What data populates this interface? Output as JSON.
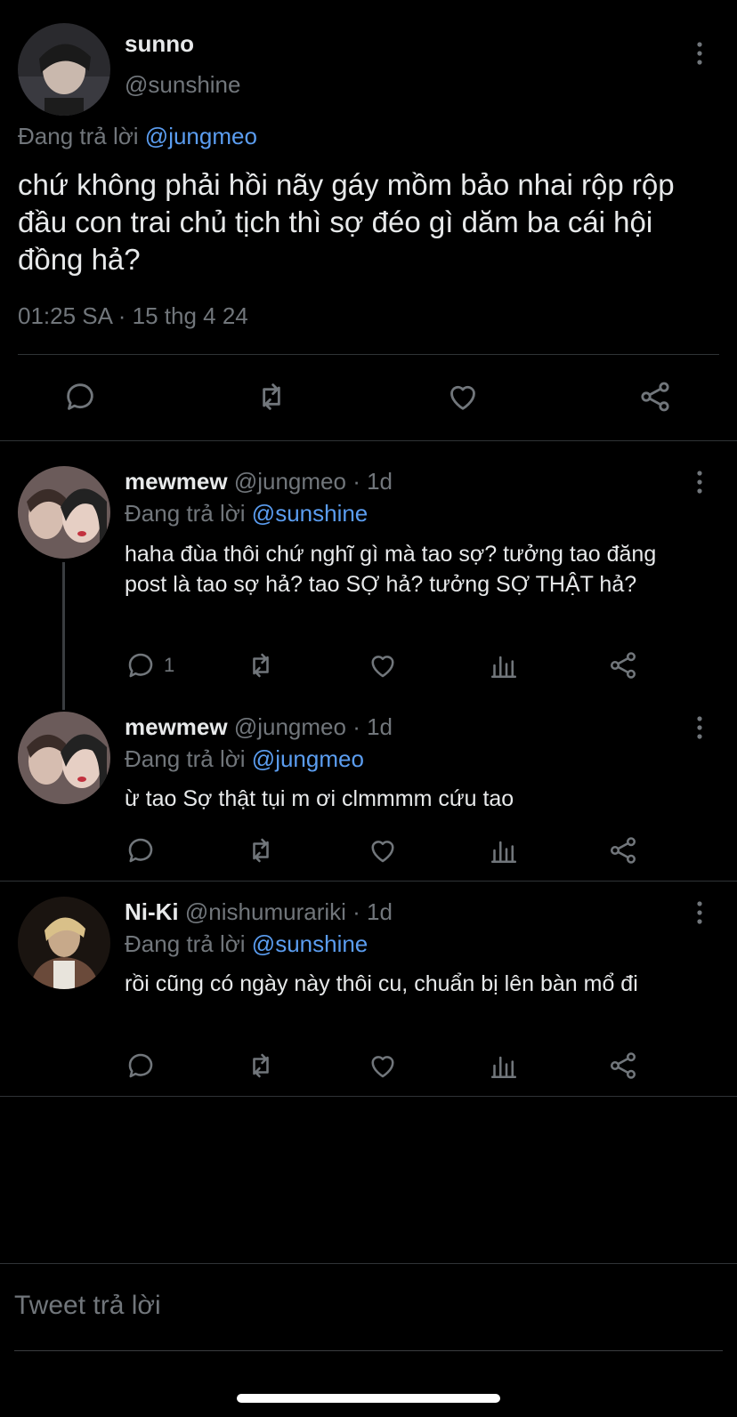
{
  "main_tweet": {
    "name": "sunno",
    "handle": "@sunshine",
    "replying_prefix": "Đang trả lời",
    "replying_to": "@jungmeo",
    "text": "chứ không phải hồi nãy gáy mồm bảo nhai rộp rộp đầu con trai chủ tịch thì sợ đéo gì dăm ba cái hội đồng hả?",
    "timestamp": "01:25 SA · 15 thg 4 24",
    "actions": [
      "reply-icon",
      "retweet-icon",
      "like-icon",
      "share-icon"
    ]
  },
  "replies": [
    {
      "name": "mewmew",
      "handle": "@jungmeo",
      "time": "· 1d",
      "replying_prefix": "Đang trả lời",
      "replying_to": "@sunshine",
      "text": "haha đùa thôi chứ nghĩ gì mà tao sợ? tưởng tao đăng post là tao sợ hả? tao SỢ hả? tưởng SỢ THẬT hả?",
      "reply_count": "1"
    },
    {
      "name": "mewmew",
      "handle": "@jungmeo",
      "time": "· 1d",
      "replying_prefix": "Đang trả lời",
      "replying_to": "@jungmeo",
      "text": "ừ tao Sợ thật tụi m ơi clmmmm cứu tao",
      "reply_count": ""
    },
    {
      "name": "Ni-Ki",
      "handle": "@nishumurariki",
      "time": "· 1d",
      "replying_prefix": "Đang trả lời",
      "replying_to": "@sunshine",
      "text": "rồi cũng có ngày này thôi cu, chuẩn bị lên bàn mổ đi",
      "reply_count": ""
    }
  ],
  "composer": {
    "placeholder": "Tweet trả lời"
  },
  "colors": {
    "background": "#000000",
    "text": "#e7e9ea",
    "secondary": "#71767b",
    "link": "#5b9df0",
    "divider": "#2f3336"
  }
}
